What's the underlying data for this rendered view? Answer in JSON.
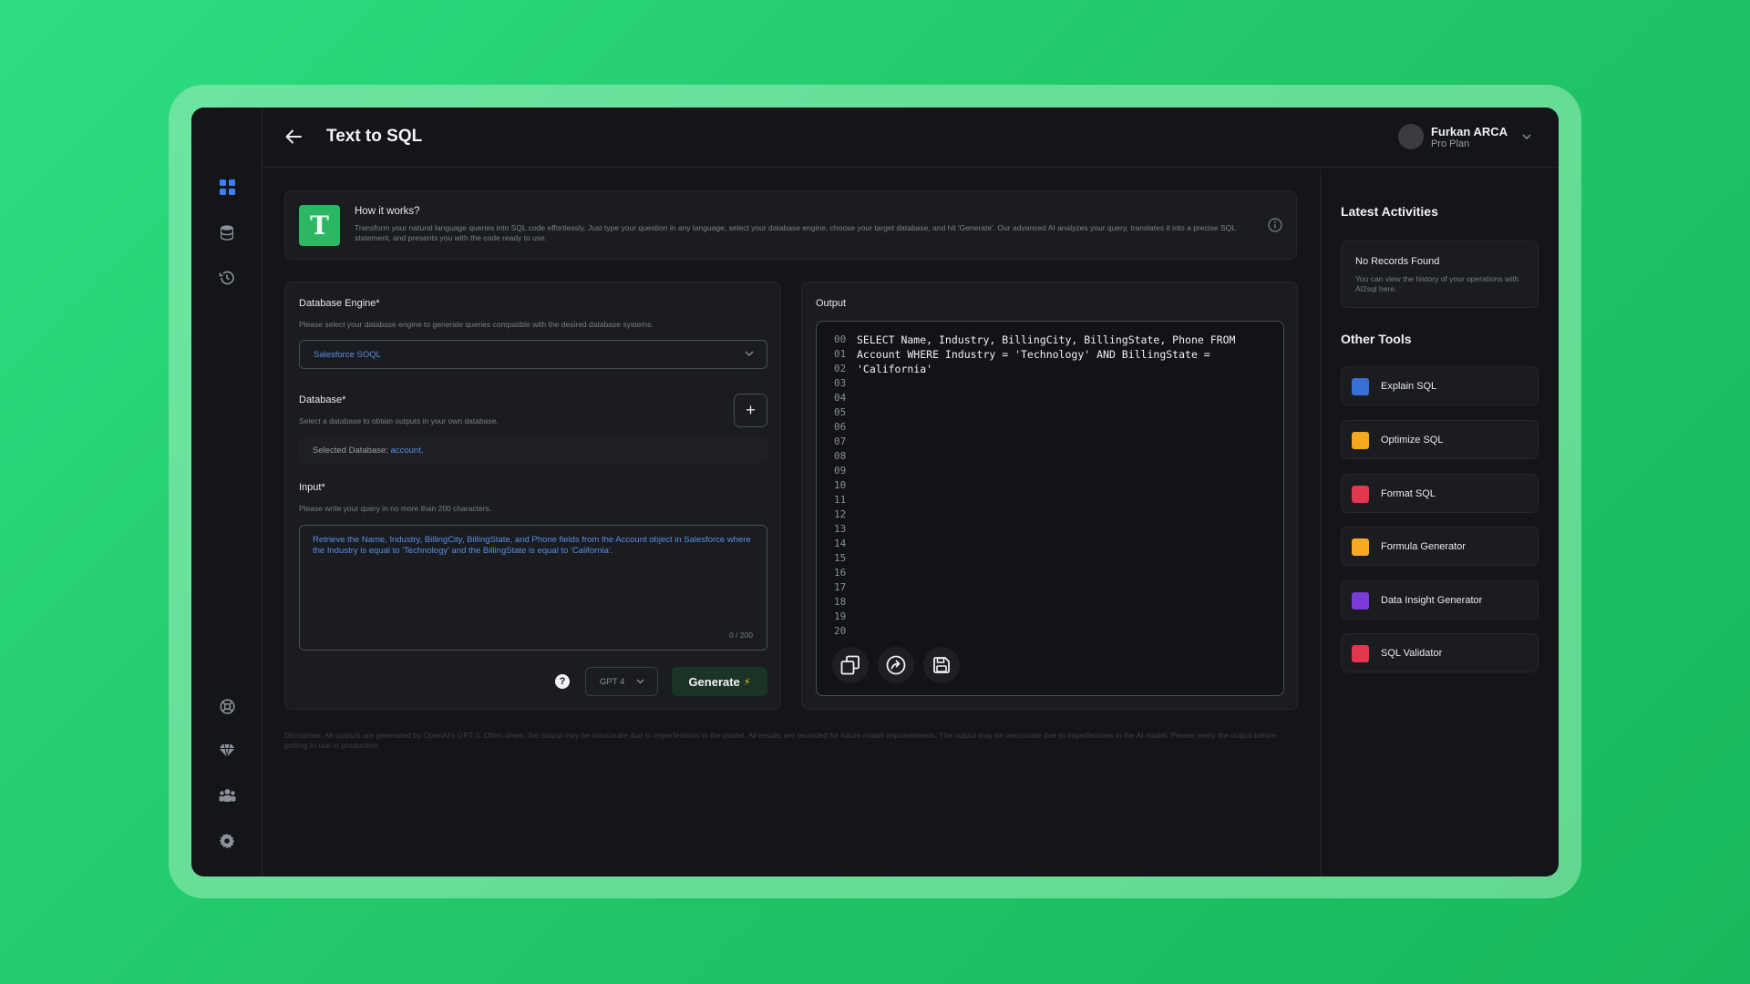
{
  "app": {
    "page_title": "Text to SQL"
  },
  "user": {
    "name": "Furkan ARCA",
    "plan": "Pro Plan"
  },
  "sidebar": {
    "top_icons": [
      "grid-icon",
      "database-icon",
      "history-icon"
    ],
    "bottom_icons": [
      "support-icon",
      "diamond-icon",
      "team-icon",
      "gear-icon"
    ]
  },
  "how_it_works": {
    "logo_letter": "T",
    "title": "How it works?",
    "description": "Transform your natural language queries into SQL code effortlessly. Just type your question in any language, select your database engine, choose your target database, and hit 'Generate'. Our advanced AI analyzes your query, translates it into a precise SQL statement, and presents you with the code ready to use."
  },
  "form": {
    "engine_label": "Database Engine*",
    "engine_hint": "Please select your database engine to generate queries compatible with the desired database systems.",
    "engine_value": "Salesforce SOQL",
    "database_label": "Database*",
    "database_hint": "Select a database to obtain outputs in your own database.",
    "add_database_label": "+",
    "selected_db_prefix": "Selected Database:",
    "selected_db_value": "account,",
    "input_label": "Input*",
    "input_hint": "Please write your query in no more than 200 characters.",
    "input_value": "Retrieve the Name, Industry, BillingCity, BillingState, and Phone fields from the Account object in Salesforce where the Industry is equal to 'Technology' and the BillingState is equal to 'California'.",
    "char_count": "0 / 200",
    "help_label": "?",
    "model_value": "GPT 4",
    "generate_label": "Generate",
    "generate_bolt": "⚡"
  },
  "output": {
    "label": "Output",
    "line_numbers": [
      "00",
      "01",
      "02",
      "03",
      "04",
      "05",
      "06",
      "07",
      "08",
      "09",
      "10",
      "11",
      "12",
      "13",
      "14",
      "15",
      "16",
      "17",
      "18",
      "19",
      "20"
    ],
    "code": "SELECT Name, Industry, BillingCity, BillingState, Phone FROM Account WHERE Industry = 'Technology' AND BillingState = 'California'",
    "actions": [
      "copy-icon",
      "share-icon",
      "save-icon"
    ]
  },
  "disclaimer": "Disclaimer: All outputs are generated by OpenAI's GPT-3. Often times, the output may be inaccurate due to imperfections in the model. All results are recorded for future model improvements. The output may be inaccurate due to imperfections in the AI model. Please verify the output before putting to use in production.",
  "activities": {
    "title": "Latest Activities",
    "empty_title": "No Records Found",
    "empty_desc": "You can view the history of your operations with AI2sql here."
  },
  "other_tools": {
    "title": "Other Tools",
    "items": [
      {
        "label": "Explain SQL",
        "color": "#3b6fd8"
      },
      {
        "label": "Optimize SQL",
        "color": "#f6a821"
      },
      {
        "label": "Format SQL",
        "color": "#e0374e"
      },
      {
        "label": "Formula Generator",
        "color": "#f6a821"
      },
      {
        "label": "Data Insight Generator",
        "color": "#7c3ad8"
      },
      {
        "label": "SQL Validator",
        "color": "#e0374e"
      }
    ]
  },
  "colors": {
    "accent_blue": "#5b8ee6",
    "brand_green": "#2cb765"
  }
}
